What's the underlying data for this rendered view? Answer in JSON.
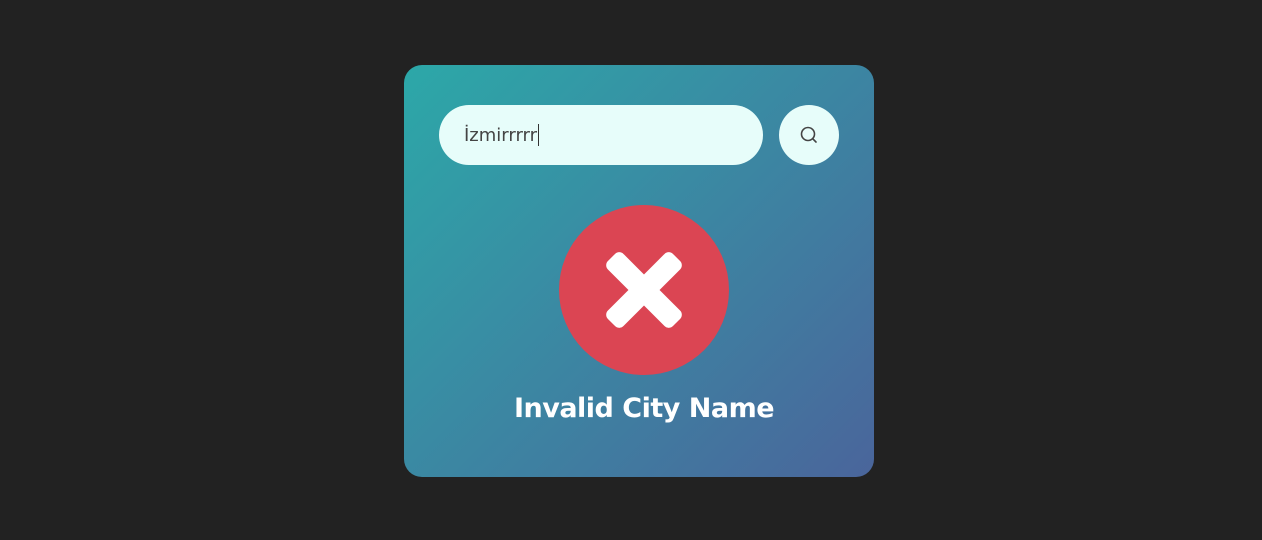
{
  "search": {
    "value": "İzmirrrrr",
    "icon": "search-icon"
  },
  "error": {
    "icon": "error-x-icon",
    "color": "#db4553",
    "message": "Invalid City Name"
  },
  "colors": {
    "background": "#222222",
    "card_gradient_start": "#2ca8a8",
    "card_gradient_end": "#4a659b",
    "input_background": "#e7fdfa"
  }
}
